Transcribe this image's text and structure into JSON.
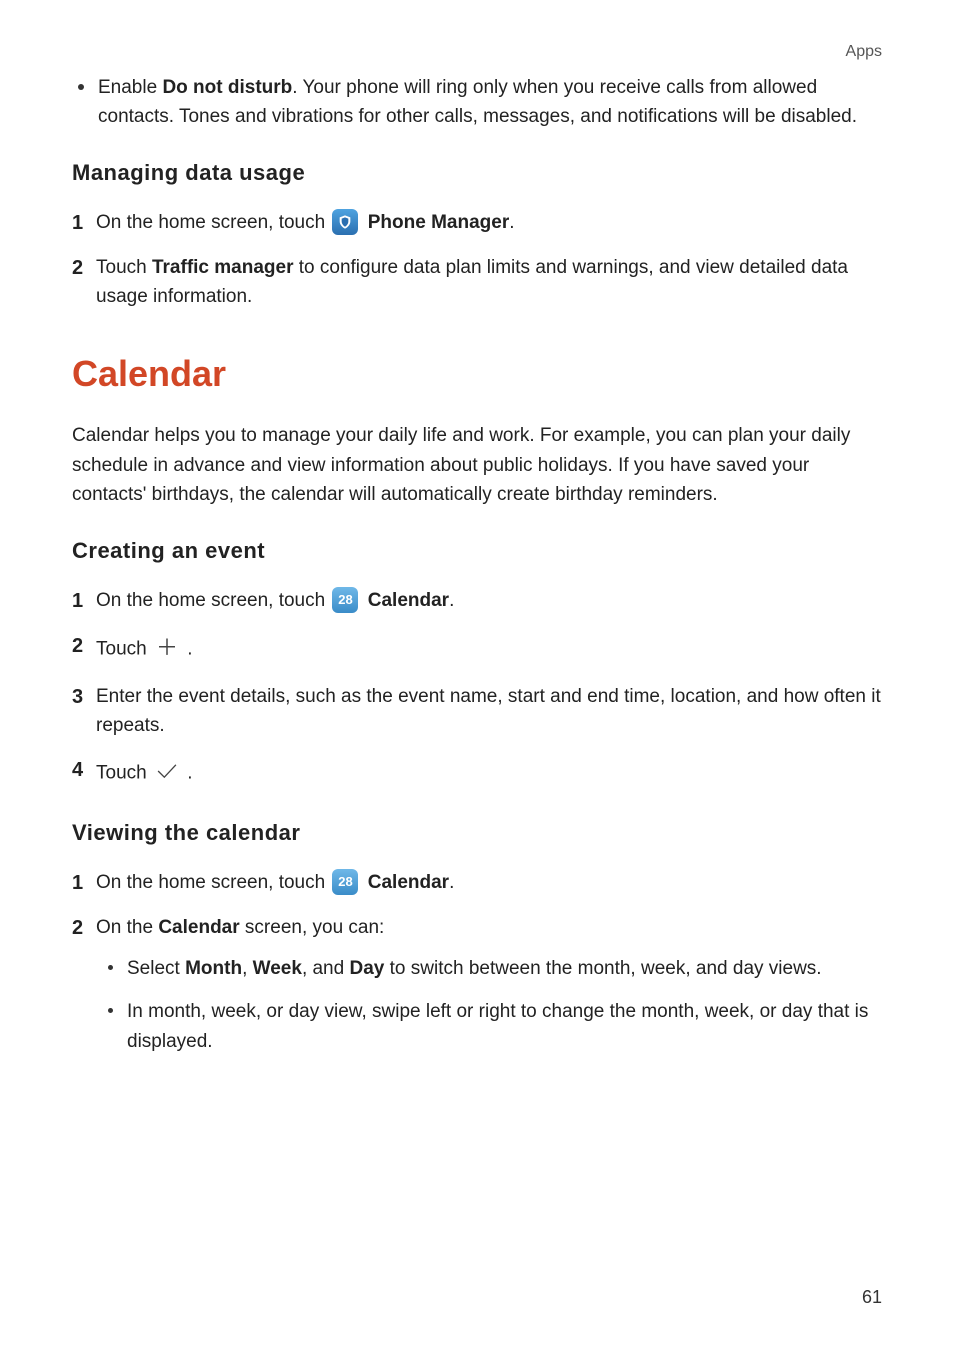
{
  "header": {
    "section": "Apps"
  },
  "dnd": {
    "prefix": "Enable ",
    "bold": "Do not disturb",
    "suffix": ". Your phone will ring only when you receive calls from allowed contacts. Tones and vibrations for other calls, messages, and notifications will be disabled."
  },
  "managing": {
    "heading": "Managing data usage",
    "step1_num": "1",
    "step1_a": "On the home screen, touch ",
    "step1_b": "Phone Manager",
    "step1_c": ".",
    "step2_num": "2",
    "step2_a": "Touch ",
    "step2_b": "Traffic manager",
    "step2_c": " to configure data plan limits and warnings, and view detailed data usage information."
  },
  "calendar": {
    "heading": "Calendar",
    "intro": "Calendar helps you to manage your daily life and work. For example, you can plan your daily schedule in advance and view information about public holidays. If you have saved your contacts' birthdays, the calendar will automatically create birthday reminders."
  },
  "creating": {
    "heading": "Creating an event",
    "s1_num": "1",
    "s1_a": "On the home screen, touch ",
    "s1_b": "Calendar",
    "s1_c": ".",
    "s2_num": "2",
    "s2_a": "Touch ",
    "s2_b": ".",
    "s3_num": "3",
    "s3_a": "Enter the event details, such as the event name, start and end time, location, and how often it repeats.",
    "s4_num": "4",
    "s4_a": "Touch ",
    "s4_b": "."
  },
  "viewing": {
    "heading": "Viewing the calendar",
    "s1_num": "1",
    "s1_a": "On the home screen, touch ",
    "s1_b": "Calendar",
    "s1_c": ".",
    "s2_num": "2",
    "s2_a": "On the ",
    "s2_b": "Calendar",
    "s2_c": " screen, you can:",
    "b1_a": "Select ",
    "b1_m": "Month",
    "b1_sep1": ", ",
    "b1_w": "Week",
    "b1_sep2": ", and ",
    "b1_d": "Day",
    "b1_z": " to switch between the month, week, and day views.",
    "b2": "In month, week, or day view, swipe left or right to change the month, week, or day that is displayed."
  },
  "icons": {
    "calendar_day": "28"
  },
  "pageNumber": "61"
}
